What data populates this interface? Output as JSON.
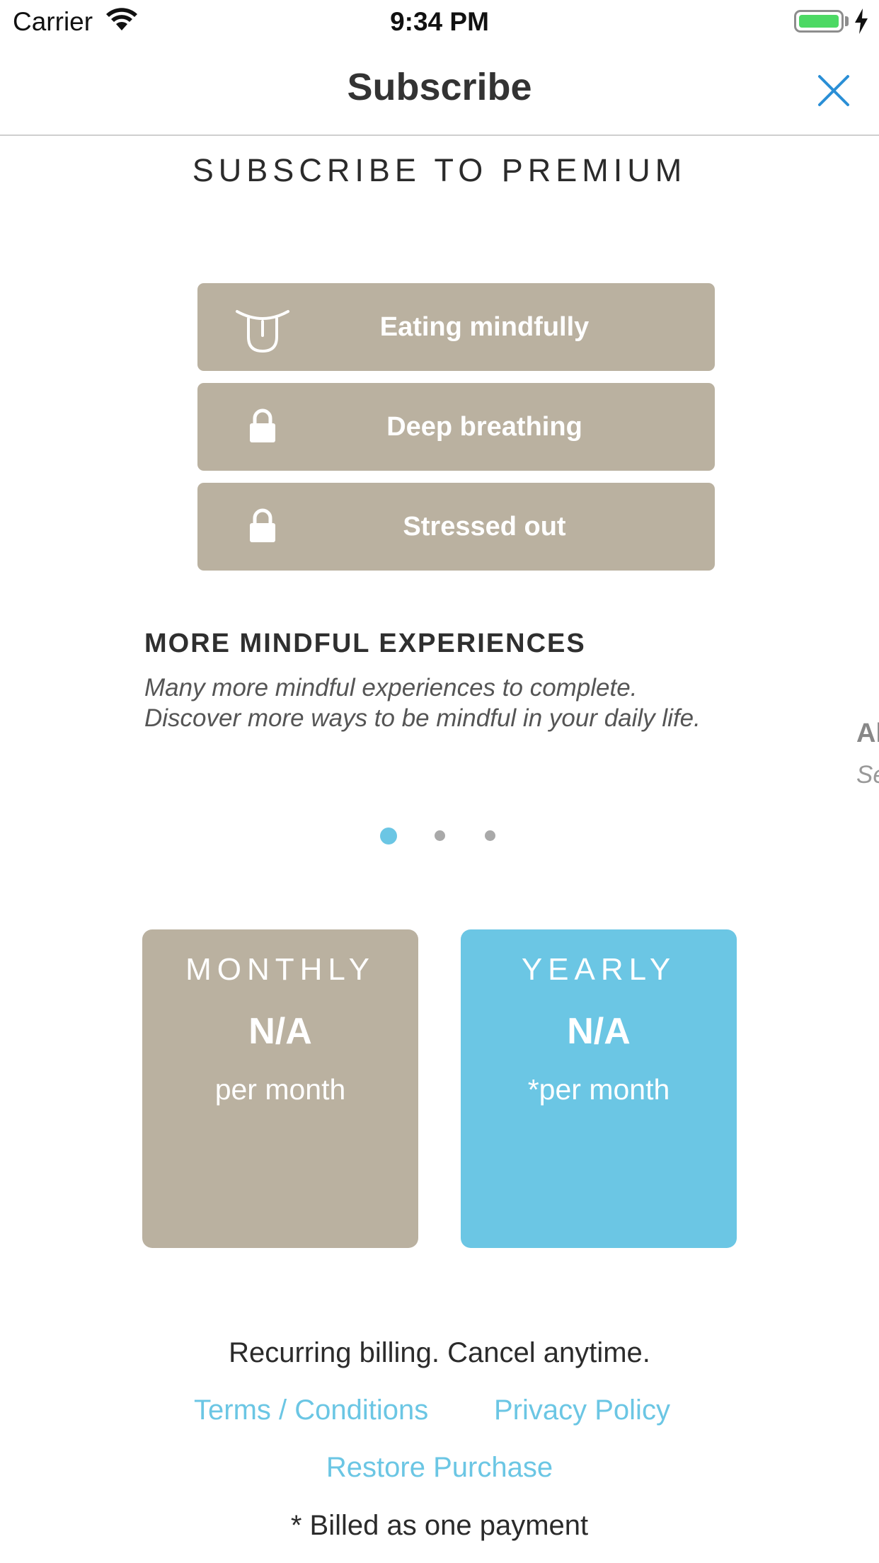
{
  "status_bar": {
    "carrier": "Carrier",
    "time": "9:34 PM",
    "battery_icon": "battery-full-icon",
    "signal_icon": "wifi-icon",
    "charging_icon": "charging-bolt-icon"
  },
  "nav": {
    "title": "Subscribe",
    "close_icon": "close-icon"
  },
  "heading": "SUBSCRIBE TO PREMIUM",
  "exercises": [
    {
      "label": "Eating mindfully",
      "icon": "tongue-icon",
      "locked": false
    },
    {
      "label": "Deep breathing",
      "icon": "lock-icon",
      "locked": true
    },
    {
      "label": "Stressed out",
      "icon": "lock-icon",
      "locked": true
    }
  ],
  "carousel": {
    "title": "MORE MINDFUL EXPERIENCES",
    "description": "Many more mindful experiences to complete. Discover more ways to be mindful in your daily life.",
    "next_title_peek": "Al",
    "next_desc_peek": "Se",
    "page_count": 3,
    "active_page": 1
  },
  "plans": [
    {
      "name": "MONTHLY",
      "price": "N/A",
      "period": "per month"
    },
    {
      "name": "YEARLY",
      "price": "N/A",
      "period": "*per month"
    }
  ],
  "footer": {
    "billing_note": "Recurring billing. Cancel anytime.",
    "terms": "Terms / Conditions",
    "privacy": "Privacy Policy",
    "restore": "Restore Purchase",
    "footnote": "* Billed as one payment"
  },
  "colors": {
    "accent": "#6bc6e4",
    "tan": "#bab1a0",
    "battery_green": "#4cd964"
  }
}
